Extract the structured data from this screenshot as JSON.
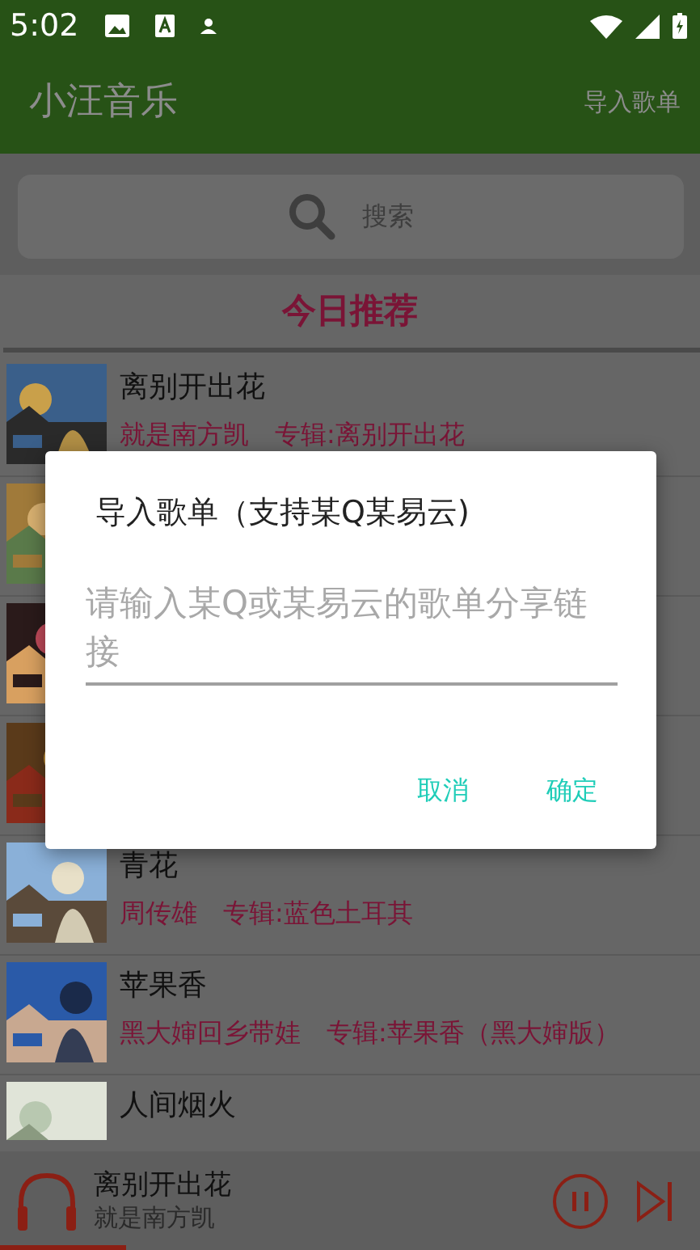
{
  "status_bar": {
    "time": "5:02"
  },
  "app_bar": {
    "title": "小汪音乐",
    "action": "导入歌单"
  },
  "search": {
    "placeholder": "搜索"
  },
  "section": {
    "title": "今日推荐"
  },
  "songs": [
    {
      "cover": {
        "kind": "picture"
      },
      "title": "离别开出花",
      "artist": "就是南方凯",
      "album": "专辑:离别开出花"
    },
    {
      "cover": {
        "kind": "picture"
      }
    },
    {
      "cover": {
        "kind": "picture"
      }
    },
    {
      "cover": {
        "kind": "picture"
      }
    },
    {
      "cover": {
        "kind": "picture"
      },
      "title": "青花",
      "artist": "周传雄",
      "album": "专辑:蓝色土耳其"
    },
    {
      "cover": {
        "kind": "picture"
      },
      "title": "苹果香",
      "artist": "黑大婶回乡带娃",
      "album": "专辑:苹果香（黑大婶版）"
    },
    {
      "cover": {
        "kind": "picture"
      },
      "title": "人间烟火"
    }
  ],
  "player": {
    "title": "离别开出花",
    "artist": "就是南方凯",
    "playing": true,
    "level": 0.18
  },
  "dialog": {
    "title": "导入歌单（支持某Q某易云)",
    "placeholder": "请输入某Q或某易云的歌单分享链接",
    "buttons": [
      "取消",
      "确定"
    ]
  }
}
